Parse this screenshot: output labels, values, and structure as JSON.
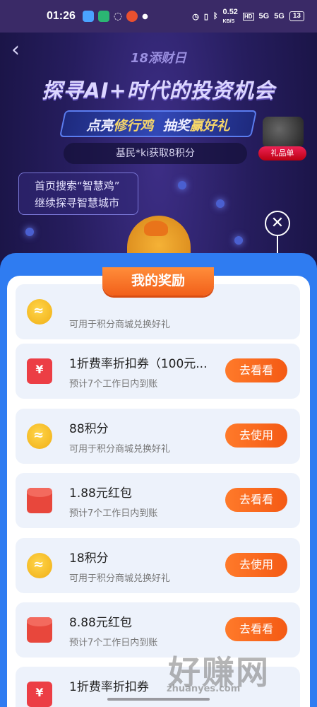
{
  "status_bar": {
    "time": "01:26",
    "net_speed": "0.52",
    "net_unit": "KB/S",
    "signal_1": "5G",
    "signal_2": "5G",
    "hd": "HD",
    "battery": "13"
  },
  "header": {
    "event_tag": "18添财日",
    "headline": "探寻AI+时代的投资机会",
    "subline_part1": "点亮",
    "subline_hl1": "修行鸡",
    "subline_part2": "  抽奖",
    "subline_hl2": "赢好礼",
    "gift_list_label": "礼品单",
    "points_banner": "基民*ki获取8积分",
    "search_tip_line1": "首页搜索“智慧鸡”",
    "search_tip_line2": "继续探寻智慧城市"
  },
  "modal": {
    "title": "我的奖励",
    "close_icon": "close-icon",
    "items": [
      {
        "icon": "coin-icon",
        "title": "",
        "desc": "可用于积分商城兑换好礼",
        "button": ""
      },
      {
        "icon": "coupon-icon",
        "title": "1折费率折扣券（100元...",
        "desc": "预计7个工作日内到账",
        "button": "去看看"
      },
      {
        "icon": "coin-icon",
        "title": "88积分",
        "desc": "可用于积分商城兑换好礼",
        "button": "去使用"
      },
      {
        "icon": "red-packet-icon",
        "title": "1.88元红包",
        "desc": "预计7个工作日内到账",
        "button": "去看看"
      },
      {
        "icon": "coin-icon",
        "title": "18积分",
        "desc": "可用于积分商城兑换好礼",
        "button": "去使用"
      },
      {
        "icon": "red-packet-icon",
        "title": "8.88元红包",
        "desc": "预计7个工作日内到账",
        "button": "去看看"
      },
      {
        "icon": "coupon-icon",
        "title": "1折费率折扣券",
        "desc": "",
        "button": ""
      }
    ]
  },
  "watermark": {
    "text": "好赚网",
    "url": "zhuanyes.com"
  },
  "colors": {
    "modal_blue": "#2f7cf1",
    "button_orange": "#f45a14",
    "item_bg": "#edf2fb"
  }
}
